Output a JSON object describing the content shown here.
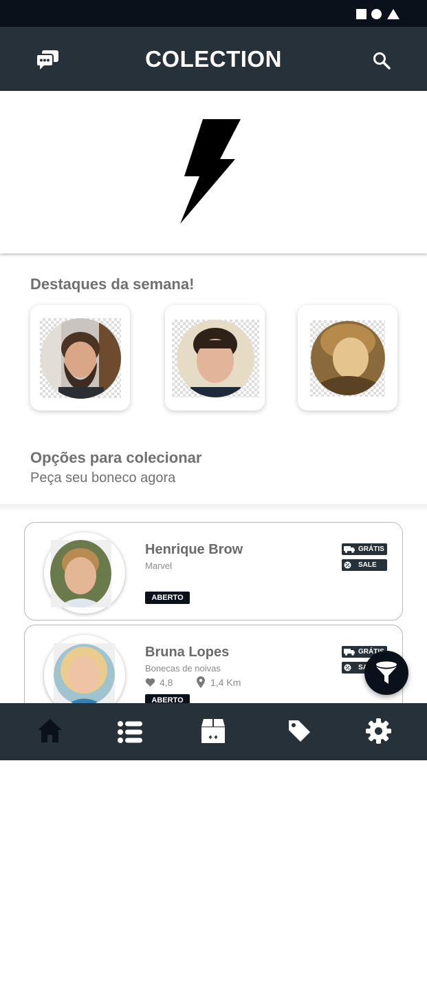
{
  "app": {
    "title": "COLECTION"
  },
  "colors": {
    "header": "#27313a",
    "status_bar": "#0a111a",
    "text_gray": "#707070",
    "badge_dark": "#27313a",
    "tag_black": "#0a111a"
  },
  "header": {
    "left_icon": "chat-icon",
    "right_icon": "search-icon"
  },
  "banner": {
    "icon": "lightning-bolt-icon"
  },
  "featured": {
    "title": "Destaques da semana!",
    "items": [
      {
        "name": "bearded-man-avatar"
      },
      {
        "name": "young-man-avatar"
      },
      {
        "name": "woman-avatar"
      }
    ]
  },
  "options": {
    "title": "Opções para colecionar",
    "subtitle": "Peça seu boneco agora"
  },
  "list": {
    "items": [
      {
        "name": "Henrique Brow",
        "category": "Marvel",
        "status": "ABERTO",
        "badges": [
          "GRÁTIS",
          "SALE"
        ]
      },
      {
        "name": "Bruna Lopes",
        "category": "Bonecas de noivas",
        "rating": "4,8",
        "distance": "1,4 Km",
        "status": "ABERTO",
        "badges": [
          "GRÁTIS",
          "SALE"
        ]
      }
    ]
  },
  "fab": {
    "icon": "filter-icon"
  },
  "bottom_nav": {
    "items": [
      {
        "icon": "home-icon",
        "active": true
      },
      {
        "icon": "list-icon"
      },
      {
        "icon": "box-icon"
      },
      {
        "icon": "tag-icon"
      },
      {
        "icon": "gear-icon"
      }
    ]
  }
}
